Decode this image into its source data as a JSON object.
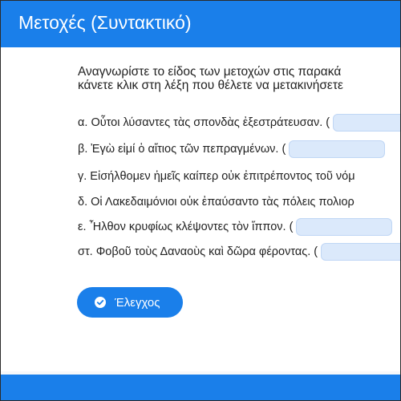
{
  "header": {
    "title": "Μετοχές (Συντακτικό)"
  },
  "instructions": {
    "line1": "Αναγνωρίστε το είδος των μετοχών στις παρακά",
    "line2": "κάνετε κλικ στη λέξη που θέλετε να μετακινήσετε"
  },
  "items": [
    {
      "text": "α. Οὗτοι λύσαντες τὰς σπονδὰς ἐξεστράτευσαν. ("
    },
    {
      "text": "β. Ἐγὼ εἰμί ὁ αἴτιος τῶν πεπραγμένων. ("
    },
    {
      "text": "γ. Εἰσήλθομεν ἡμεῖς καίπερ οὐκ ἐπιτρέποντος τοῦ νόμ"
    },
    {
      "text": "δ. Οἱ Λακεδαιμόνιοι οὐκ ἐπαύσαντο τὰς πόλεις πολιορ"
    },
    {
      "text": "ε. Ἦλθον κρυφίως κλέψοντες τὸν ἵππον. ("
    },
    {
      "text": "στ. Φοβοῦ τοὺς Δαναοὺς καὶ δῶρα φέροντας. ("
    }
  ],
  "check_button": {
    "label": "Έλεγχος",
    "icon": "check-circle-icon"
  },
  "colors": {
    "accent": "#1a7fea",
    "drop_zone": "#dbe9fb"
  }
}
